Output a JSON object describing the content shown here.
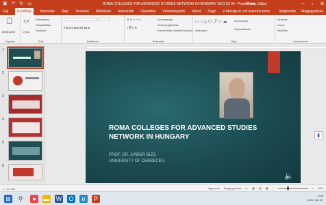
{
  "app": {
    "window_title": "ROMA COLLEGES FOR ADVANCED STUDIES NETWORK IN HUNGARY 2021 03 30 - PowerPoint",
    "user": "Barna, Gábor",
    "colors": {
      "accent": "#c43e1c",
      "slide_bg": "#1b4b50",
      "red_tab": "#c0392b"
    }
  },
  "ribbon": {
    "tabs": [
      "Fájl",
      "Kezdőlap",
      "Beszúrás",
      "Rajz",
      "Tervezés",
      "Áttűnések",
      "Animációk",
      "Diavetítés",
      "Véleményezés",
      "Nézet",
      "Súgó"
    ],
    "active_tab": "Kezdőlap",
    "search_placeholder": "Mondja el, mit szeretne tenni",
    "right_actions": [
      "Megosztás",
      "Megjegyzések"
    ],
    "groups": [
      "Vágólap",
      "Diák",
      "Betűtípus",
      "Bekezdés",
      "Rajz",
      "Szerkesztés"
    ],
    "clipboard": {
      "paste": "Beillesztés",
      "new_slide": "Új dia"
    },
    "slides_group": [
      "Elrendezés",
      "Visszaállítás",
      "Szakasz"
    ],
    "paragraph": [
      "Szövegirány",
      "Szöveg igazítása",
      "Konvertálás SmartArt ábrává"
    ],
    "drawing": [
      "Alakzatok",
      "Elrendezés",
      "Gyorsstílusok"
    ],
    "editing": [
      "Keresés",
      "Csere",
      "Kijelölés"
    ]
  },
  "thumbnails": [
    {
      "num": "1",
      "selected": true,
      "icon": "slide-1"
    },
    {
      "num": "2",
      "selected": false,
      "icon": "slide-2"
    },
    {
      "num": "3",
      "selected": false,
      "icon": "slide-3"
    },
    {
      "num": "4",
      "selected": false,
      "icon": "slide-4"
    },
    {
      "num": "5",
      "selected": false,
      "icon": "slide-5"
    },
    {
      "num": "6",
      "selected": false,
      "icon": "slide-6"
    }
  ],
  "slide": {
    "title": "ROMA COLLEGES FOR ADVANCED STUDIES NETWORK IN HUNGARY",
    "author": "PROF. DR. GÁBOR BIZÓ",
    "institution": "UNIVERSITY OF DEBRECEN"
  },
  "statusbar": {
    "slide_info": "1 / 34. dia",
    "language": "magyar",
    "notes": "Jegyzetek",
    "comments": "Megjegyzések",
    "zoom": "69%"
  },
  "taskbar": {
    "time": "9:05",
    "date": "2021. 03. 30.",
    "apps": [
      "windows-start-icon",
      "search-icon",
      "chrome-icon",
      "file-explorer-icon",
      "word-icon",
      "outlook-icon",
      "edge-icon",
      "powerpoint-icon"
    ]
  }
}
